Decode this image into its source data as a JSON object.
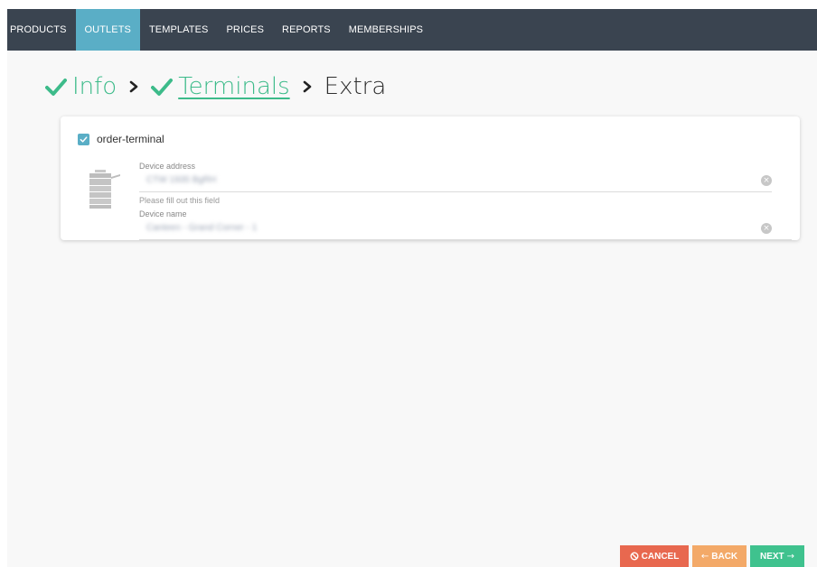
{
  "nav": {
    "items": [
      {
        "label": "PRODUCTS",
        "active": false
      },
      {
        "label": "OUTLETS",
        "active": true
      },
      {
        "label": "TEMPLATES",
        "active": false
      },
      {
        "label": "PRICES",
        "active": false
      },
      {
        "label": "REPORTS",
        "active": false
      },
      {
        "label": "MEMBERSHIPS",
        "active": false
      }
    ]
  },
  "wizard": {
    "steps": [
      {
        "label": "Info",
        "state": "done"
      },
      {
        "label": "Terminals",
        "state": "done-link"
      },
      {
        "label": "Extra",
        "state": "current"
      }
    ]
  },
  "terminal": {
    "checkbox_label": "order-terminal",
    "checked": true,
    "icon": "printer-icon",
    "device_address": {
      "label": "Device address",
      "value": "CTW 1935 BgRH",
      "hint": "Please fill out this field"
    },
    "device_name": {
      "label": "Device name",
      "value": "Canteen - Grand Corner - 1"
    }
  },
  "actions": {
    "cancel_label": "CANCEL",
    "back_label": "BACK",
    "next_label": "NEXT"
  },
  "colors": {
    "nav_bg": "#3a4450",
    "nav_active": "#5aaec6",
    "success": "#3dbb8a",
    "cancel": "#e8684f",
    "back": "#f3a968",
    "next": "#3fc28e"
  }
}
